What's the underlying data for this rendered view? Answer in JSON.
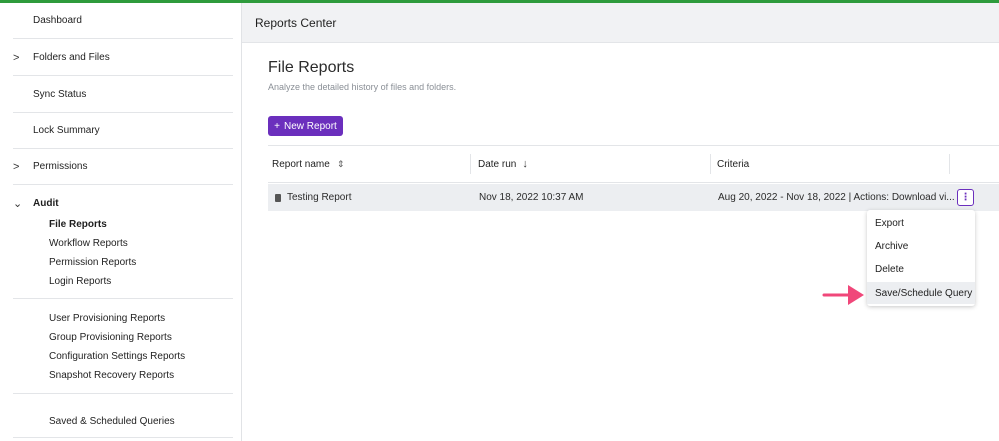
{
  "sidebar": {
    "dashboard": "Dashboard",
    "folders_files": "Folders and Files",
    "sync_status": "Sync Status",
    "lock_summary": "Lock Summary",
    "permissions": "Permissions",
    "audit": "Audit",
    "audit_items": [
      "File Reports",
      "Workflow Reports",
      "Permission Reports",
      "Login Reports"
    ],
    "provisioning_items": [
      "User Provisioning Reports",
      "Group Provisioning Reports",
      "Configuration Settings Reports",
      "Snapshot Recovery Reports"
    ],
    "saved_queries": "Saved & Scheduled Queries"
  },
  "header": {
    "title": "Reports Center"
  },
  "main": {
    "title": "File Reports",
    "subtitle": "Analyze the detailed history of files and folders.",
    "new_button": "New Report",
    "columns": {
      "name": "Report name",
      "date": "Date run",
      "criteria": "Criteria"
    },
    "rows": [
      {
        "name": "Testing Report",
        "date": "Nov 18, 2022 10:37 AM",
        "criteria": "Aug 20, 2022 - Nov 18, 2022 | Actions: Download vi..."
      }
    ],
    "menu": [
      "Export",
      "Archive",
      "Delete",
      "Save/Schedule Query"
    ]
  },
  "colors": {
    "accent": "#6b2fbd",
    "top_line": "#2e9b3c",
    "arrow": "#f0477a"
  }
}
